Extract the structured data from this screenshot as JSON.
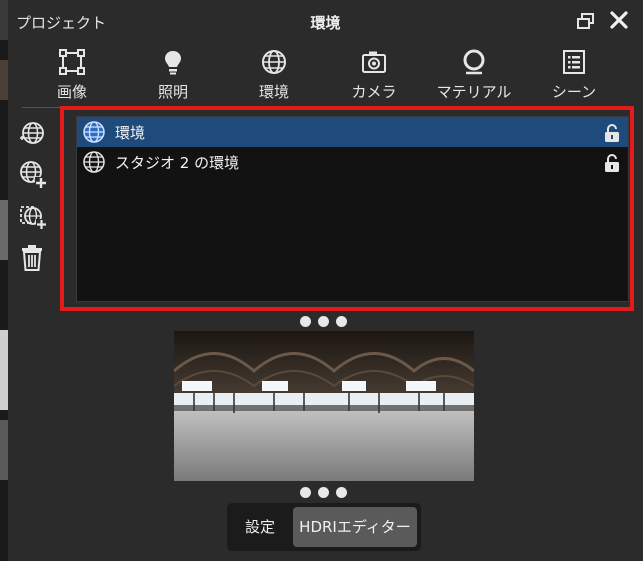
{
  "titlebar": {
    "left_title": "プロジェクト",
    "center_title": "環境"
  },
  "toolbar": {
    "items": [
      {
        "label": "画像",
        "icon": "crop-frame-icon"
      },
      {
        "label": "照明",
        "icon": "lightbulb-icon"
      },
      {
        "label": "環境",
        "icon": "globe-icon"
      },
      {
        "label": "カメラ",
        "icon": "camera-icon"
      },
      {
        "label": "マテリアル",
        "icon": "material-sphere-icon"
      },
      {
        "label": "シーン",
        "icon": "scene-list-icon"
      }
    ]
  },
  "sidebar": {
    "buttons": [
      {
        "icon": "add-environment-globe-icon"
      },
      {
        "icon": "new-environment-globe-plus-icon"
      },
      {
        "icon": "duplicate-environment-icon"
      },
      {
        "icon": "trash-icon"
      }
    ]
  },
  "environments": {
    "items": [
      {
        "name": "環境",
        "selected": true,
        "locked": true
      },
      {
        "name": "スタジオ 2 の環境",
        "selected": false,
        "locked": true
      }
    ]
  },
  "bottom_tabs": {
    "settings": "設定",
    "hdri_editor": "HDRIエディター",
    "active": "hdri_editor"
  },
  "colors": {
    "selection": "#1e4b7c",
    "highlight_border": "#e31b1b",
    "panel_bg": "#2b2b2b",
    "list_bg": "#121212"
  }
}
